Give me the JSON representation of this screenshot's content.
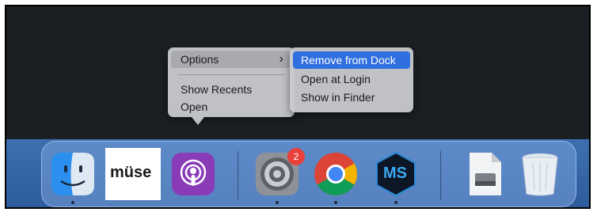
{
  "context_menu": {
    "options_label": "Options",
    "submenu_arrow": "›",
    "show_recents": "Show Recents",
    "open": "Open"
  },
  "submenu": {
    "remove_from_dock": "Remove from Dock",
    "open_at_login": "Open at Login",
    "show_in_finder": "Show in Finder"
  },
  "dock": {
    "muse_logo_text": "müse",
    "settings_badge": "2",
    "ms_logo_text": "MS"
  },
  "colors": {
    "menu_highlight": "#2f6fe0",
    "badge": "#e8403a"
  },
  "icons": [
    "finder-icon",
    "muse-icon",
    "podcasts-icon",
    "system-settings-icon",
    "chrome-icon",
    "ms-app-icon",
    "disk-utility-doc-icon",
    "trash-icon"
  ]
}
